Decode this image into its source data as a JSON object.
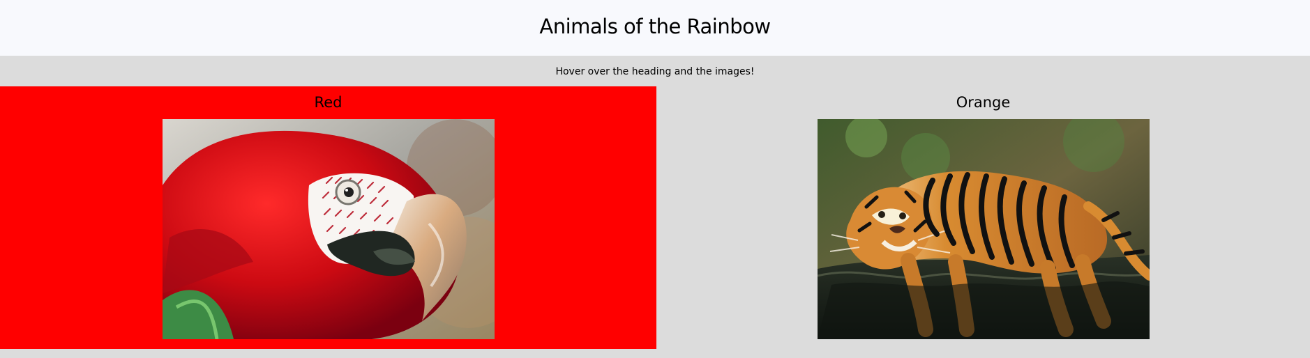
{
  "header": {
    "title": "Animals of the Rainbow"
  },
  "hint": "Hover over the heading and the images!",
  "cards": [
    {
      "title": "Red",
      "image_icon": "macaw-photo",
      "accent": "#ff0000"
    },
    {
      "title": "Orange",
      "image_icon": "tiger-photo",
      "accent": "#dcdcdc"
    }
  ],
  "colors": {
    "header_bg": "#f8f9fd",
    "page_bg": "#dcdcdc",
    "active_card": "#ff0000"
  }
}
